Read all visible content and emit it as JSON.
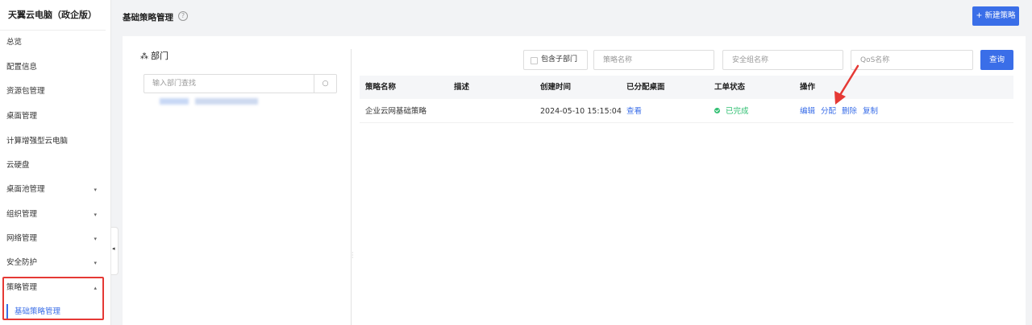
{
  "sidebar": {
    "brand": "天翼云电脑（政企版）",
    "items": [
      {
        "label": "总览",
        "arrow": ""
      },
      {
        "label": "配置信息",
        "arrow": ""
      },
      {
        "label": "资源包管理",
        "arrow": ""
      },
      {
        "label": "桌面管理",
        "arrow": ""
      },
      {
        "label": "计算增强型云电脑",
        "arrow": ""
      },
      {
        "label": "云硬盘",
        "arrow": ""
      },
      {
        "label": "桌面池管理",
        "arrow": "▾"
      },
      {
        "label": "组织管理",
        "arrow": "▾"
      },
      {
        "label": "网络管理",
        "arrow": "▾"
      },
      {
        "label": "安全防护",
        "arrow": "▾"
      },
      {
        "label": "策略管理",
        "arrow": "▴"
      }
    ],
    "sub_item": "基础策略管理",
    "collapse_glyph": "◂"
  },
  "header": {
    "title": "基础策略管理",
    "help_glyph": "?",
    "new_button": "+ 新建策略"
  },
  "dept": {
    "title": "部门",
    "tree_glyph": "⁂",
    "search_placeholder": "输入部门查找",
    "search_glyph": "○"
  },
  "filters": {
    "include_sub_dept": "包含子部门",
    "policy_name_placeholder": "策略名称",
    "security_group_placeholder": "安全组名称",
    "qos_placeholder": "QoS名称",
    "query_button": "查询"
  },
  "table": {
    "headers": [
      "策略名称",
      "描述",
      "创建时间",
      "已分配桌面",
      "工单状态",
      "操作"
    ],
    "rows": [
      {
        "name": "企业云网基础策略",
        "description": "",
        "created": "2024-05-10 15:15:04",
        "assigned": "查看",
        "status": "已完成",
        "ops": [
          "编辑",
          "分配",
          "删除",
          "复制"
        ]
      }
    ]
  },
  "colors": {
    "accent": "#3a6ee8",
    "success": "#2fbf71",
    "highlight": "#e53935"
  },
  "icons": [
    "tree-icon",
    "help-icon",
    "search-icon",
    "check-icon",
    "chevron-down-icon",
    "chevron-up-icon",
    "collapse-left-icon"
  ]
}
